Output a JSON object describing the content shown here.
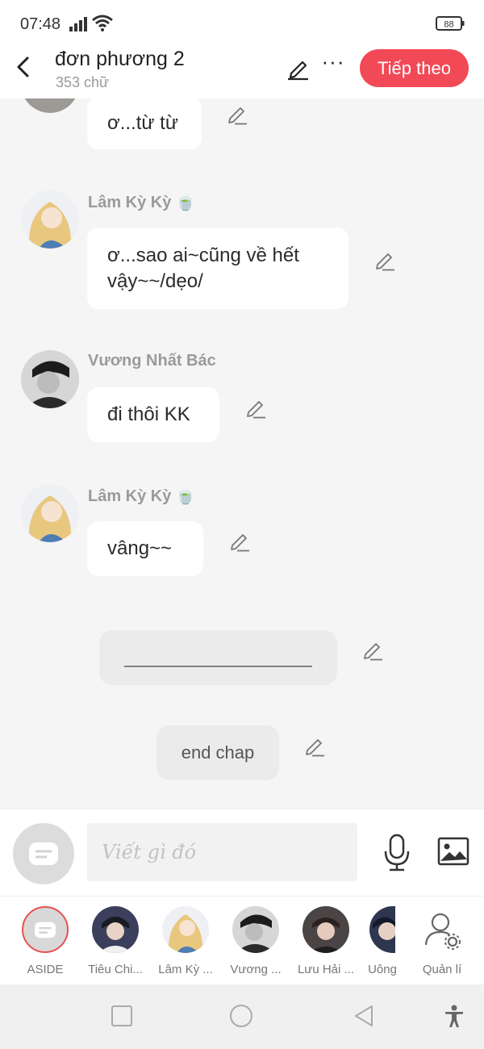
{
  "status": {
    "time": "07:48",
    "battery": "88"
  },
  "header": {
    "title": "đơn phương 2",
    "word_count": "353 chữ",
    "more_label": "···",
    "next_label": "Tiếp theo"
  },
  "messages": [
    {
      "sender": "",
      "text": "ơ...từ từ"
    },
    {
      "sender": "Lâm Kỳ Kỳ 🍵",
      "text": "ơ...sao ai~cũng về hết vậy~~/dẹo/"
    },
    {
      "sender": "Vương Nhất Bác",
      "text": "đi thôi KK"
    },
    {
      "sender": "Lâm Kỳ Kỳ 🍵",
      "text": "vâng~~"
    }
  ],
  "narrations": [
    {
      "text": "___________________"
    },
    {
      "text": "end chap"
    }
  ],
  "input": {
    "placeholder": "Viết gì đó"
  },
  "characters": [
    {
      "name": "ASIDE"
    },
    {
      "name": "Tiêu Chi..."
    },
    {
      "name": "Lâm Kỳ ..."
    },
    {
      "name": "Vương ..."
    },
    {
      "name": "Lưu Hải ..."
    },
    {
      "name": "Uông"
    },
    {
      "name": "Quản lí"
    }
  ],
  "colors": {
    "accent": "#f24956",
    "aside_border": "#e85050",
    "bubble": "#ffffff",
    "narration_bg": "#ebebeb",
    "chat_bg": "#f5f5f5"
  },
  "icons": [
    "signal-icon",
    "wifi-icon",
    "battery-icon",
    "back-arrow-icon",
    "pencil-icon",
    "more-icon",
    "mic-icon",
    "image-icon",
    "aside-chat-icon",
    "manage-user-icon",
    "nav-square-icon",
    "nav-circle-icon",
    "nav-back-triangle-icon",
    "accessibility-icon"
  ]
}
